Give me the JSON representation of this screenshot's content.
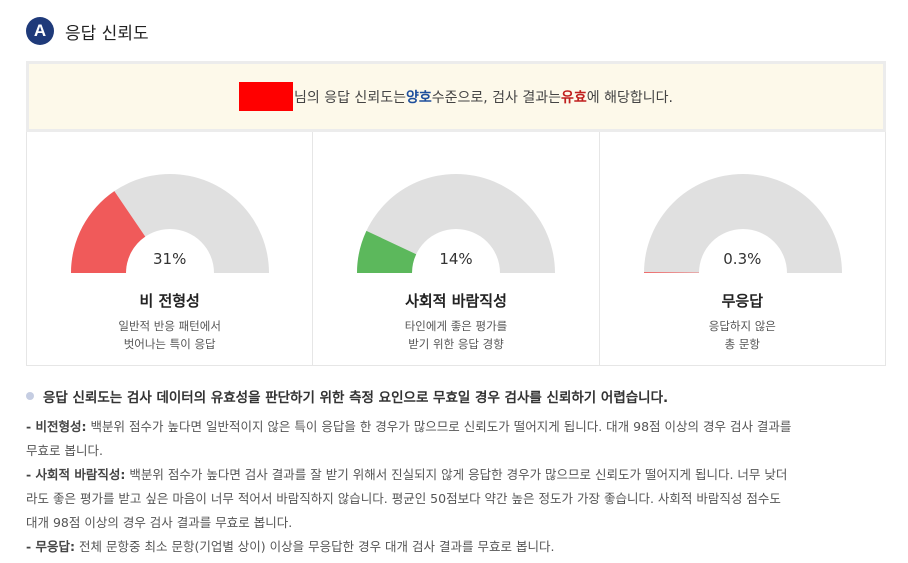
{
  "header": {
    "badge": "A",
    "title": "응답 신뢰도"
  },
  "summary": {
    "suffix_1": "님의 응답 신뢰도는 ",
    "level": "양호",
    "suffix_2": " 수준으로, 검사 결과는 ",
    "result": "유효",
    "suffix_3": "에 해당합니다.",
    "colors": {
      "redact": "#ff0000",
      "level": "#1e4f9c",
      "result": "#c0201e"
    }
  },
  "gauges": [
    {
      "value_text": "31%",
      "value": 31,
      "label": "비 전형성",
      "desc_1": "일반적 반응 패턴에서",
      "desc_2": "벗어나는 특이 응답",
      "color": "#f05a5a"
    },
    {
      "value_text": "14%",
      "value": 14,
      "label": "사회적 바람직성",
      "desc_1": "타인에게 좋은 평가를",
      "desc_2": "받기 위한 응답 경향",
      "color": "#5cb85c"
    },
    {
      "value_text": "0.3%",
      "value": 0.3,
      "label": "무응답",
      "desc_1": "응답하지 않은",
      "desc_2": "총 문항",
      "color": "#f05a5a"
    }
  ],
  "gauge_track_color": "#e0e0e0",
  "notes": {
    "title": "응답 신뢰도는 검사 데이터의 유효성을 판단하기 위한 측정 요인으로 무효일 경우 검사를 신뢰하기 어렵습니다.",
    "item1_label": "- 비전형성:",
    "item1_line1": " 백분위 점수가 높다면 일반적이지 않은 특이 응답을 한 경우가 많으므로 신뢰도가 떨어지게 됩니다. 대개 98점 이상의 경우 검사 결과를",
    "item1_line2": "무효로 봅니다.",
    "item2_label": "- 사회적 바람직성:",
    "item2_line1": " 백분위 점수가 높다면 검사 결과를 잘 받기 위해서 진실되지 않게 응답한 경우가 많으므로 신뢰도가 떨어지게 됩니다. 너무 낮더",
    "item2_line2": "라도 좋은 평가를 받고 싶은 마음이 너무 적어서 바람직하지 않습니다. 평균인 50점보다 약간 높은 정도가 가장 좋습니다. 사회적 바람직성 점수도",
    "item2_line3": "대개 98점 이상의 경우 검사 결과를 무효로 봅니다.",
    "item3_label": "- 무응답:",
    "item3_line1": " 전체 문항중 최소 문항(기업별 상이) 이상을 무응답한 경우 대개 검사 결과를 무효로 봅니다."
  }
}
